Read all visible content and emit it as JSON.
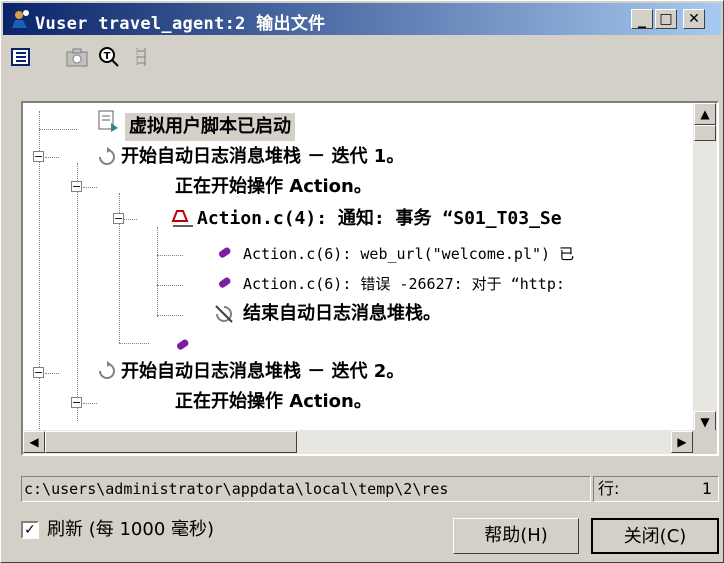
{
  "window": {
    "title": "Vuser travel_agent:2 输出文件",
    "controls": {
      "minimize_icon": "_",
      "maximize_icon": "□",
      "close_icon": "✕"
    }
  },
  "toolbar": {
    "icons": [
      "detail-view-icon",
      "snapshot-icon",
      "find-icon",
      "tree-icon"
    ]
  },
  "tree": {
    "rows": [
      {
        "text": "虚拟用户脚本已启动",
        "icon": "doc-icon"
      },
      {
        "text": "开始自动日志消息堆栈 － 迭代 1。",
        "icon": "cycle-icon"
      },
      {
        "text": "正在开始操作 Action。",
        "icon": ""
      },
      {
        "text": "Action.c(4): 通知: 事务 “S01_T03_Se",
        "icon": "notify-icon"
      },
      {
        "text": "Action.c(6): web_url(\"welcome.pl\") 已",
        "icon": "pen-icon"
      },
      {
        "text": "Action.c(6): 错误 -26627: 对于 “http:",
        "icon": "pen-icon"
      },
      {
        "text": "结束自动日志消息堆栈。",
        "icon": "end-icon"
      },
      {
        "text": "",
        "icon": "pen-icon"
      },
      {
        "text": "开始自动日志消息堆栈 － 迭代 2。",
        "icon": "cycle-icon"
      },
      {
        "text": "正在开始操作 Action。",
        "icon": ""
      }
    ]
  },
  "status": {
    "path": "c:\\users\\administrator\\appdata\\local\\temp\\2\\res",
    "line_label": "行:",
    "line_value": "1"
  },
  "footer": {
    "refresh_label": "刷新 (每 1000 毫秒)",
    "refresh_checked": "✓",
    "help_button": "帮助(H)",
    "close_button": "关闭(C)"
  }
}
